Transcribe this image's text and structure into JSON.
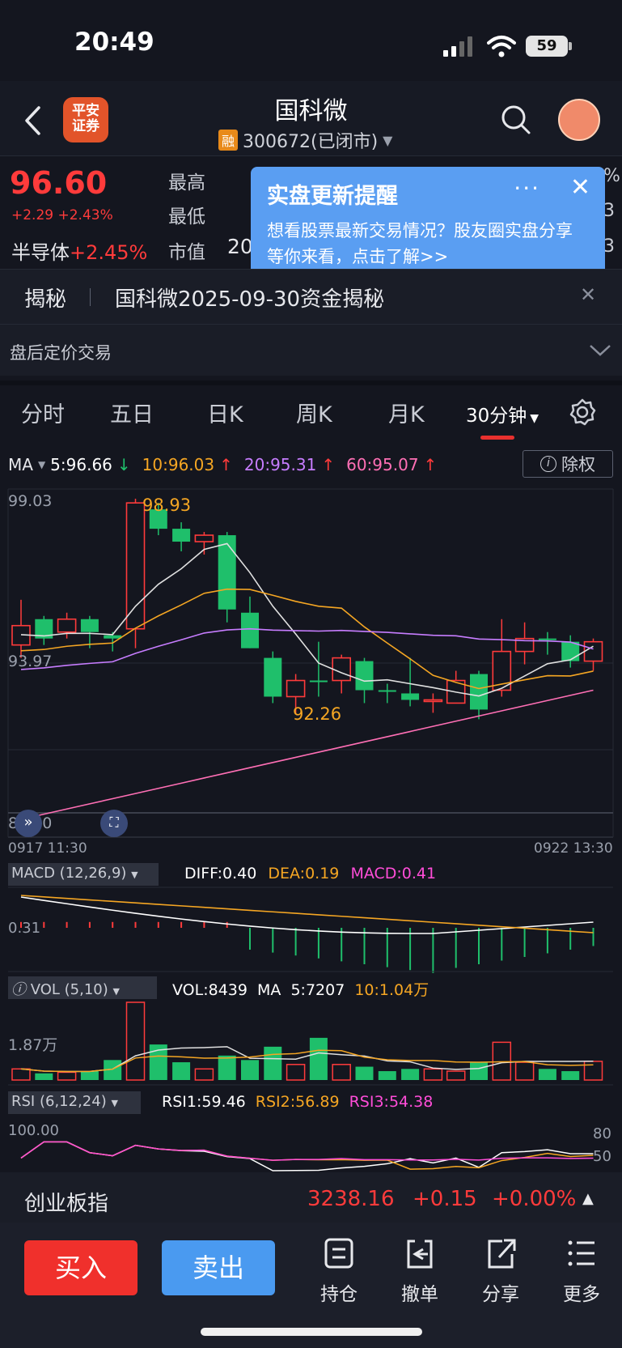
{
  "status_bar": {
    "time": "20:49",
    "battery": "59"
  },
  "header": {
    "broker_logo": "平安证券",
    "stock_name": "国科微",
    "rong_badge": "融",
    "stock_code_status": "300672(已闭市)"
  },
  "quote": {
    "price": "96.60",
    "change": "+2.29 +2.43%",
    "sector_name": "半导体",
    "sector_change": "+2.45%",
    "label_high": "最高",
    "label_low": "最低",
    "label_mktcap": "市值",
    "mktcap_partial": "20",
    "right_edge_chars": [
      "%",
      "3",
      "3"
    ]
  },
  "popup": {
    "title": "实盘更新提醒",
    "body": "想看股票最新交易情况？股友圈实盘分享等你来看，点击了解>>",
    "more": "···",
    "close": "✕"
  },
  "reveal": {
    "tag": "揭秘",
    "text": "国科微2025-09-30资金揭秘",
    "close": "✕"
  },
  "after_hours": {
    "label": "盘后定价交易"
  },
  "tabs": [
    {
      "label": "分时"
    },
    {
      "label": "五日"
    },
    {
      "label": "日K"
    },
    {
      "label": "周K"
    },
    {
      "label": "月K"
    },
    {
      "label": "30分钟"
    }
  ],
  "ma_bar": {
    "label": "MA",
    "ma5": "5:96.66",
    "ma10": "10:96.03",
    "ma20": "20:95.31",
    "ma60": "60:95.07",
    "exright": "除权"
  },
  "main_chart": {
    "y_top": "99.03",
    "y_mid": "93.97",
    "y_bottom": "88.90",
    "high_label": "98.93",
    "low_label": "92.26",
    "x_start": "0917 11:30",
    "x_end": "0922 13:30"
  },
  "macd": {
    "label": "MACD (12,26,9)",
    "diff": "DIFF:0.40",
    "dea": "DEA:0.19",
    "macd": "MACD:0.41",
    "axis": "0.31"
  },
  "vol": {
    "label": "VOL (5,10)",
    "vol": "VOL:8439",
    "ma": "MA",
    "ma5": "5:7207",
    "ma10": "10:1.04万",
    "axis": "1.87万"
  },
  "rsi": {
    "label": "RSI (6,12,24)",
    "rsi1": "RSI1:59.46",
    "rsi2": "RSI2:56.89",
    "rsi3": "RSI3:54.38",
    "axis_left": "100.00",
    "axis_r1": "80",
    "axis_r2": "50"
  },
  "index_bar": {
    "name": "创业板指",
    "value": "3238.16",
    "change": "+0.15",
    "pct": "+0.00%"
  },
  "bottom": {
    "buy": "买入",
    "sell": "卖出",
    "actions": [
      {
        "label": "持仓"
      },
      {
        "label": "撤单"
      },
      {
        "label": "分享"
      },
      {
        "label": "更多"
      }
    ]
  },
  "chart_data": {
    "type": "candlestick",
    "price_range": [
      88.9,
      99.03
    ],
    "candles": [
      {
        "o": 95.0,
        "h": 95.8,
        "l": 94.0,
        "c": 94.4,
        "dir": "up"
      },
      {
        "o": 95.2,
        "h": 95.3,
        "l": 94.4,
        "c": 94.6,
        "dir": "down"
      },
      {
        "o": 94.8,
        "h": 95.4,
        "l": 94.6,
        "c": 95.2,
        "dir": "up"
      },
      {
        "o": 95.2,
        "h": 95.3,
        "l": 94.3,
        "c": 94.8,
        "dir": "down"
      },
      {
        "o": 94.7,
        "h": 94.8,
        "l": 94.2,
        "c": 94.6,
        "dir": "down"
      },
      {
        "o": 94.9,
        "h": 98.93,
        "l": 94.3,
        "c": 98.8,
        "dir": "up"
      },
      {
        "o": 98.6,
        "h": 98.8,
        "l": 97.8,
        "c": 98.0,
        "dir": "down"
      },
      {
        "o": 98.0,
        "h": 98.2,
        "l": 97.3,
        "c": 97.6,
        "dir": "down"
      },
      {
        "o": 97.6,
        "h": 97.9,
        "l": 97.2,
        "c": 97.8,
        "dir": "up"
      },
      {
        "o": 97.8,
        "h": 97.9,
        "l": 95.1,
        "c": 95.5,
        "dir": "down"
      },
      {
        "o": 95.4,
        "h": 95.9,
        "l": 94.3,
        "c": 94.3,
        "dir": "down"
      },
      {
        "o": 94.0,
        "h": 94.2,
        "l": 92.6,
        "c": 92.8,
        "dir": "down"
      },
      {
        "o": 92.8,
        "h": 93.5,
        "l": 92.26,
        "c": 93.3,
        "dir": "up"
      },
      {
        "o": 93.3,
        "h": 94.5,
        "l": 92.8,
        "c": 93.3,
        "dir": "down"
      },
      {
        "o": 93.3,
        "h": 94.1,
        "l": 92.9,
        "c": 94.0,
        "dir": "up"
      },
      {
        "o": 93.9,
        "h": 94.0,
        "l": 92.6,
        "c": 93.0,
        "dir": "down"
      },
      {
        "o": 93.0,
        "h": 93.2,
        "l": 92.6,
        "c": 93.0,
        "dir": "down"
      },
      {
        "o": 92.9,
        "h": 94.0,
        "l": 92.5,
        "c": 92.7,
        "dir": "down"
      },
      {
        "o": 92.7,
        "h": 92.9,
        "l": 92.3,
        "c": 92.7,
        "dir": "up"
      },
      {
        "o": 92.6,
        "h": 93.6,
        "l": 92.6,
        "c": 93.3,
        "dir": "up"
      },
      {
        "o": 93.5,
        "h": 93.6,
        "l": 92.1,
        "c": 92.4,
        "dir": "down"
      },
      {
        "o": 93.0,
        "h": 95.2,
        "l": 92.8,
        "c": 94.2,
        "dir": "up"
      },
      {
        "o": 94.2,
        "h": 95.1,
        "l": 93.8,
        "c": 94.6,
        "dir": "up"
      },
      {
        "o": 94.6,
        "h": 94.8,
        "l": 94.1,
        "c": 94.6,
        "dir": "down"
      },
      {
        "o": 94.5,
        "h": 94.7,
        "l": 93.7,
        "c": 93.9,
        "dir": "down"
      },
      {
        "o": 93.9,
        "h": 94.6,
        "l": 93.6,
        "c": 94.5,
        "dir": "up"
      }
    ],
    "volumes": [
      0.5,
      0.3,
      0.35,
      0.4,
      0.9,
      3.5,
      1.6,
      0.8,
      0.5,
      1.1,
      0.9,
      1.5,
      0.7,
      1.9,
      0.7,
      0.6,
      0.4,
      0.5,
      0.5,
      0.4,
      0.8,
      1.7,
      0.8,
      0.5,
      0.4,
      0.84
    ]
  }
}
